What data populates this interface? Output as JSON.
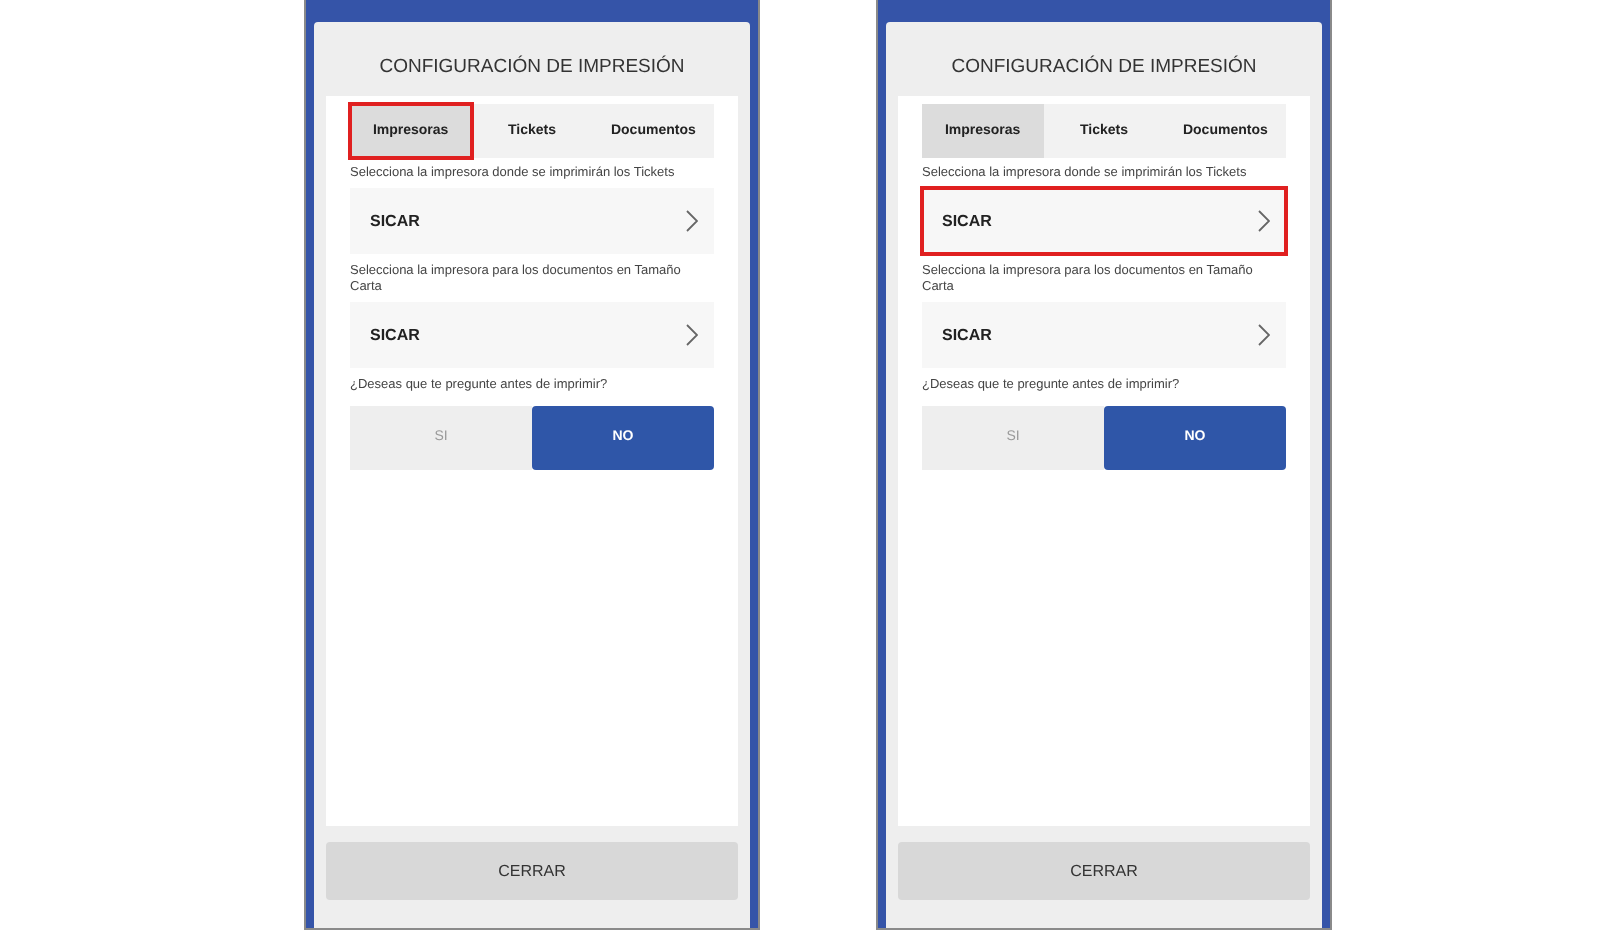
{
  "panels": [
    {
      "title": "CONFIGURACIÓN DE IMPRESIÓN",
      "tabs": [
        {
          "label": "Impresoras",
          "selected": true,
          "highlighted": true
        },
        {
          "label": "Tickets",
          "selected": false,
          "highlighted": false
        },
        {
          "label": "Documentos",
          "selected": false,
          "highlighted": false
        }
      ],
      "fields": [
        {
          "label": "Selecciona la impresora donde se imprimirán los Tickets",
          "value": "SICAR",
          "highlighted": false
        },
        {
          "label": "Selecciona la impresora para los documentos en Tamaño Carta",
          "value": "SICAR",
          "highlighted": false
        }
      ],
      "question": "¿Deseas que te pregunte antes de imprimir?",
      "options": [
        {
          "label": "SI",
          "selected": false
        },
        {
          "label": "NO",
          "selected": true
        }
      ],
      "close_button": "CERRAR"
    },
    {
      "title": "CONFIGURACIÓN DE IMPRESIÓN",
      "tabs": [
        {
          "label": "Impresoras",
          "selected": true,
          "highlighted": false
        },
        {
          "label": "Tickets",
          "selected": false,
          "highlighted": false
        },
        {
          "label": "Documentos",
          "selected": false,
          "highlighted": false
        }
      ],
      "fields": [
        {
          "label": "Selecciona la impresora donde se imprimirán los Tickets",
          "value": "SICAR",
          "highlighted": true
        },
        {
          "label": "Selecciona la impresora para los documentos en Tamaño Carta",
          "value": "SICAR",
          "highlighted": false
        }
      ],
      "question": "¿Deseas que te pregunte antes de imprimir?",
      "options": [
        {
          "label": "SI",
          "selected": false
        },
        {
          "label": "NO",
          "selected": true
        }
      ],
      "close_button": "CERRAR"
    }
  ]
}
